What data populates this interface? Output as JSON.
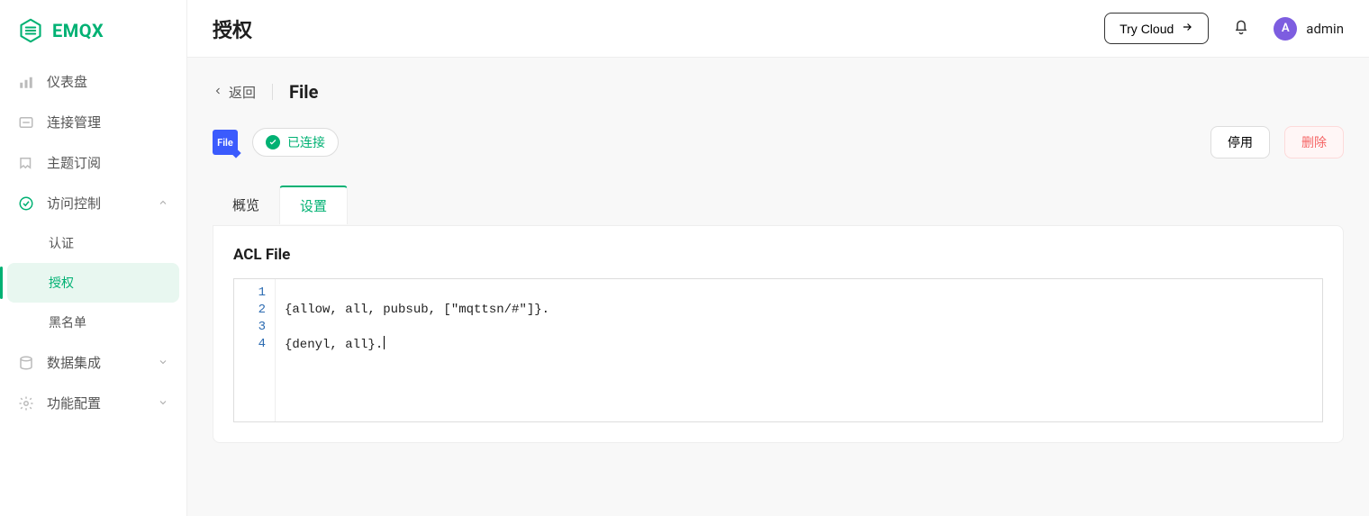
{
  "brand": {
    "name": "EMQX"
  },
  "sidebar": {
    "items": [
      {
        "label": "仪表盘"
      },
      {
        "label": "连接管理"
      },
      {
        "label": "主题订阅"
      },
      {
        "label": "访问控制"
      },
      {
        "label": "数据集成"
      },
      {
        "label": "功能配置"
      }
    ],
    "access_control_children": [
      {
        "label": "认证"
      },
      {
        "label": "授权"
      },
      {
        "label": "黑名单"
      }
    ]
  },
  "header": {
    "title": "授权",
    "try_cloud": "Try Cloud",
    "username": "admin",
    "avatar_initial": "A"
  },
  "breadcrumb": {
    "back_label": "返回",
    "title": "File"
  },
  "status": {
    "badge_text": "File",
    "connected_label": "已连接",
    "disable_label": "停用",
    "delete_label": "删除"
  },
  "tabs": {
    "overview": "概览",
    "settings": "设置"
  },
  "panel": {
    "title": "ACL File",
    "code_lines": [
      "",
      "{allow, all, pubsub, [\"mqttsn/#\"]}.",
      "",
      "{denyl, all}."
    ]
  }
}
